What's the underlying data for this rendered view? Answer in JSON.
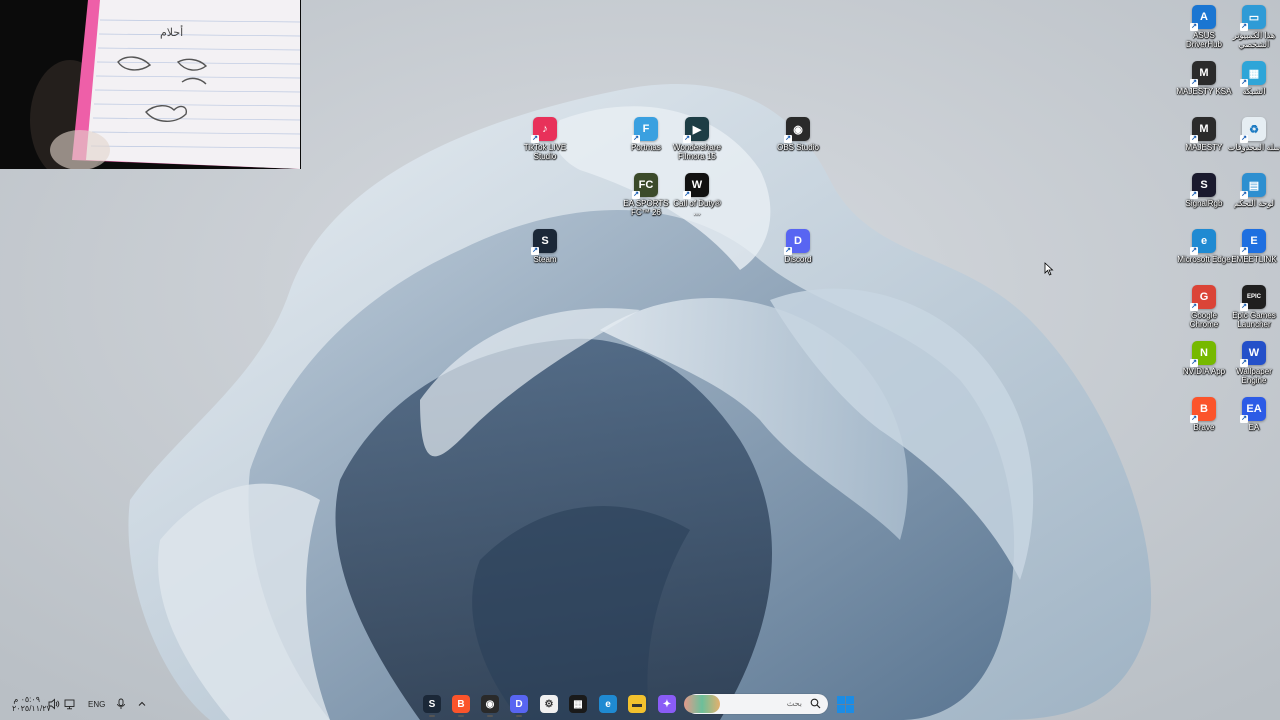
{
  "desktop_icons_center": [
    {
      "id": "tiktok",
      "label": "TikTok LIVE Studio",
      "color": "#e8315a",
      "glyph": "♪"
    },
    {
      "id": "portmaster",
      "label": "Portmas",
      "color": "#3aa0e0",
      "glyph": "F"
    },
    {
      "id": "filmora",
      "label": "Wondershare Filmora 15",
      "color": "#1d3d45",
      "glyph": "▶"
    },
    {
      "id": "obs",
      "label": "OBS Studio",
      "color": "#2a2a2a",
      "glyph": "◉"
    },
    {
      "id": "fc26",
      "label": "EA SPORTS FC™ 26",
      "color": "#3b4a2a",
      "glyph": "FC"
    },
    {
      "id": "cod",
      "label": "Call of Duty® ...",
      "color": "#111111",
      "glyph": "W"
    },
    {
      "id": "steam",
      "label": "Steam",
      "color": "#1b2838",
      "glyph": "S"
    },
    {
      "id": "discord",
      "label": "Discord",
      "color": "#5865f2",
      "glyph": "D"
    }
  ],
  "desktop_icons_right": [
    {
      "id": "asus",
      "label": "ASUS DriverHub",
      "color": "#1b76d2",
      "glyph": "A"
    },
    {
      "id": "thispc",
      "label": "هذا الكمبيوتر الشخصي",
      "color": "#2f9bd6",
      "glyph": "▭"
    },
    {
      "id": "majesty_ksa",
      "label": "MAJESTY KSA",
      "color": "#2b2b2b",
      "glyph": "M"
    },
    {
      "id": "network",
      "label": "الشبكة",
      "color": "#2ea5d8",
      "glyph": "▦"
    },
    {
      "id": "majesty",
      "label": "MAJESTY",
      "color": "#2b2b2b",
      "glyph": "M"
    },
    {
      "id": "recycle",
      "label": "سلة المحذوفات",
      "color": "#e6eef3",
      "glyph": "♻"
    },
    {
      "id": "signalrgb",
      "label": "SignalRgb",
      "color": "#1a1a2e",
      "glyph": "S"
    },
    {
      "id": "controlpanel",
      "label": "لوحة التحكم",
      "color": "#2d8fd0",
      "glyph": "▤"
    },
    {
      "id": "edge",
      "label": "Microsoft Edge",
      "color": "#1f8ad2",
      "glyph": "e"
    },
    {
      "id": "emeetlink",
      "label": "EMEETLINK",
      "color": "#1e6fe0",
      "glyph": "E"
    },
    {
      "id": "chrome",
      "label": "Google Chrome",
      "color": "#db4437",
      "glyph": "G"
    },
    {
      "id": "epic",
      "label": "Epic Games Launcher",
      "color": "#1f1f1f",
      "glyph": "EPIC"
    },
    {
      "id": "nvidia",
      "label": "NVIDIA App",
      "color": "#76b900",
      "glyph": "N"
    },
    {
      "id": "wallpaper",
      "label": "Wallpaper Engine",
      "color": "#2450c9",
      "glyph": "W"
    },
    {
      "id": "brave",
      "label": "Brave",
      "color": "#fb542b",
      "glyph": "B"
    },
    {
      "id": "ea",
      "label": "EA",
      "color": "#2c5be6",
      "glyph": "EA"
    }
  ],
  "webcam": {
    "notebook_text": "أحلام"
  },
  "taskbar": {
    "search_placeholder": "بحث",
    "apps": [
      {
        "id": "steam",
        "color": "#1b2838",
        "glyph": "S"
      },
      {
        "id": "brave",
        "color": "#fb542b",
        "glyph": "B"
      },
      {
        "id": "obs",
        "color": "#2a2a2a",
        "glyph": "◉"
      },
      {
        "id": "discord",
        "color": "#5865f2",
        "glyph": "D"
      },
      {
        "id": "settings",
        "color": "#f0f0f0",
        "glyph": "⚙"
      },
      {
        "id": "store",
        "color": "#1a1a1a",
        "glyph": "▦"
      },
      {
        "id": "edge",
        "color": "#1f8ad2",
        "glyph": "e"
      },
      {
        "id": "explorer",
        "color": "#f2c12e",
        "glyph": "▬"
      },
      {
        "id": "copilot",
        "color": "#8a5cf6",
        "glyph": "✦"
      }
    ],
    "clock_time": "٠٥:٠٩ م",
    "clock_date": "٢٠٢٥/١١/٢٧",
    "language": "ENG"
  }
}
